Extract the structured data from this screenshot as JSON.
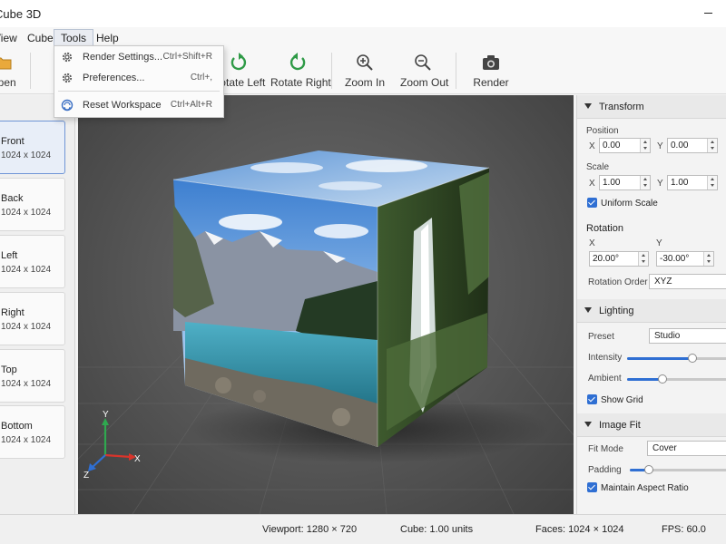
{
  "window": {
    "title": "Cube 3D"
  },
  "menubar": {
    "items": [
      {
        "label": "View"
      },
      {
        "label": "Cube"
      },
      {
        "label": "Tools"
      },
      {
        "label": "Help"
      }
    ]
  },
  "tools_menu": {
    "items": [
      {
        "label": "Render Settings...",
        "shortcut": "Ctrl+Shift+R",
        "icon": "gear-icon"
      },
      {
        "label": "Preferences...",
        "shortcut": "Ctrl+,",
        "icon": "gear-icon"
      },
      {
        "label": "Reset Workspace",
        "shortcut": "Ctrl+Alt+R",
        "icon": "reset-icon"
      }
    ]
  },
  "toolbar": {
    "open_label": "Open",
    "rotate_left_label": "Rotate Left",
    "rotate_right_label": "Rotate Right",
    "zoom_in_label": "Zoom In",
    "zoom_out_label": "Zoom Out",
    "render_label": "Render"
  },
  "faces": [
    {
      "name": "Front",
      "size": "1024 x 1024",
      "selected": true
    },
    {
      "name": "Back",
      "size": "1024 x 1024",
      "selected": false
    },
    {
      "name": "Left",
      "size": "1024 x 1024",
      "selected": false
    },
    {
      "name": "Right",
      "size": "1024 x 1024",
      "selected": false
    },
    {
      "name": "Top",
      "size": "1024 x 1024",
      "selected": false
    },
    {
      "name": "Bottom",
      "size": "1024 x 1024",
      "selected": false
    }
  ],
  "viewport": {
    "axes": {
      "x": "X",
      "y": "Y",
      "z": "Z"
    },
    "axis_colors": {
      "x": "#d9342b",
      "y": "#2fa84f",
      "z": "#2f6fd3"
    }
  },
  "panel": {
    "transform": {
      "title": "Transform",
      "position_label": "Position",
      "position_x_label": "X",
      "position_x": "0.00",
      "position_y_label": "Y",
      "position_y": "0.00",
      "scale_label": "Scale",
      "scale_x_label": "X",
      "scale_x": "1.00",
      "scale_y_label": "Y",
      "scale_y": "1.00",
      "uniform_scale_label": "Uniform Scale",
      "uniform_scale": true
    },
    "rotation": {
      "title": "Rotation",
      "x_label": "X",
      "x": "20.00°",
      "y_label": "Y",
      "y": "-30.00°",
      "order_label": "Rotation Order",
      "order": "XYZ"
    },
    "lighting": {
      "title": "Lighting",
      "preset_label": "Preset",
      "preset": "Studio",
      "intensity_label": "Intensity",
      "intensity": 0.65,
      "ambient_label": "Ambient",
      "ambient": 0.35,
      "show_grid_label": "Show Grid",
      "show_grid": true
    },
    "image_fit": {
      "title": "Image Fit",
      "fit_mode_label": "Fit Mode",
      "fit_mode": "Cover",
      "padding_label": "Padding",
      "padding": 0.2,
      "maintain_aspect_label": "Maintain Aspect Ratio",
      "maintain_aspect": true
    }
  },
  "statusbar": {
    "viewport": "Viewport:  1280 × 720",
    "cube": "Cube:  1.00 units",
    "faces": "Faces:  1024 × 1024",
    "fps": "FPS:  60.0"
  },
  "colors": {
    "accent": "#2f6fd3",
    "rotate_icon": "#2e9a46"
  }
}
